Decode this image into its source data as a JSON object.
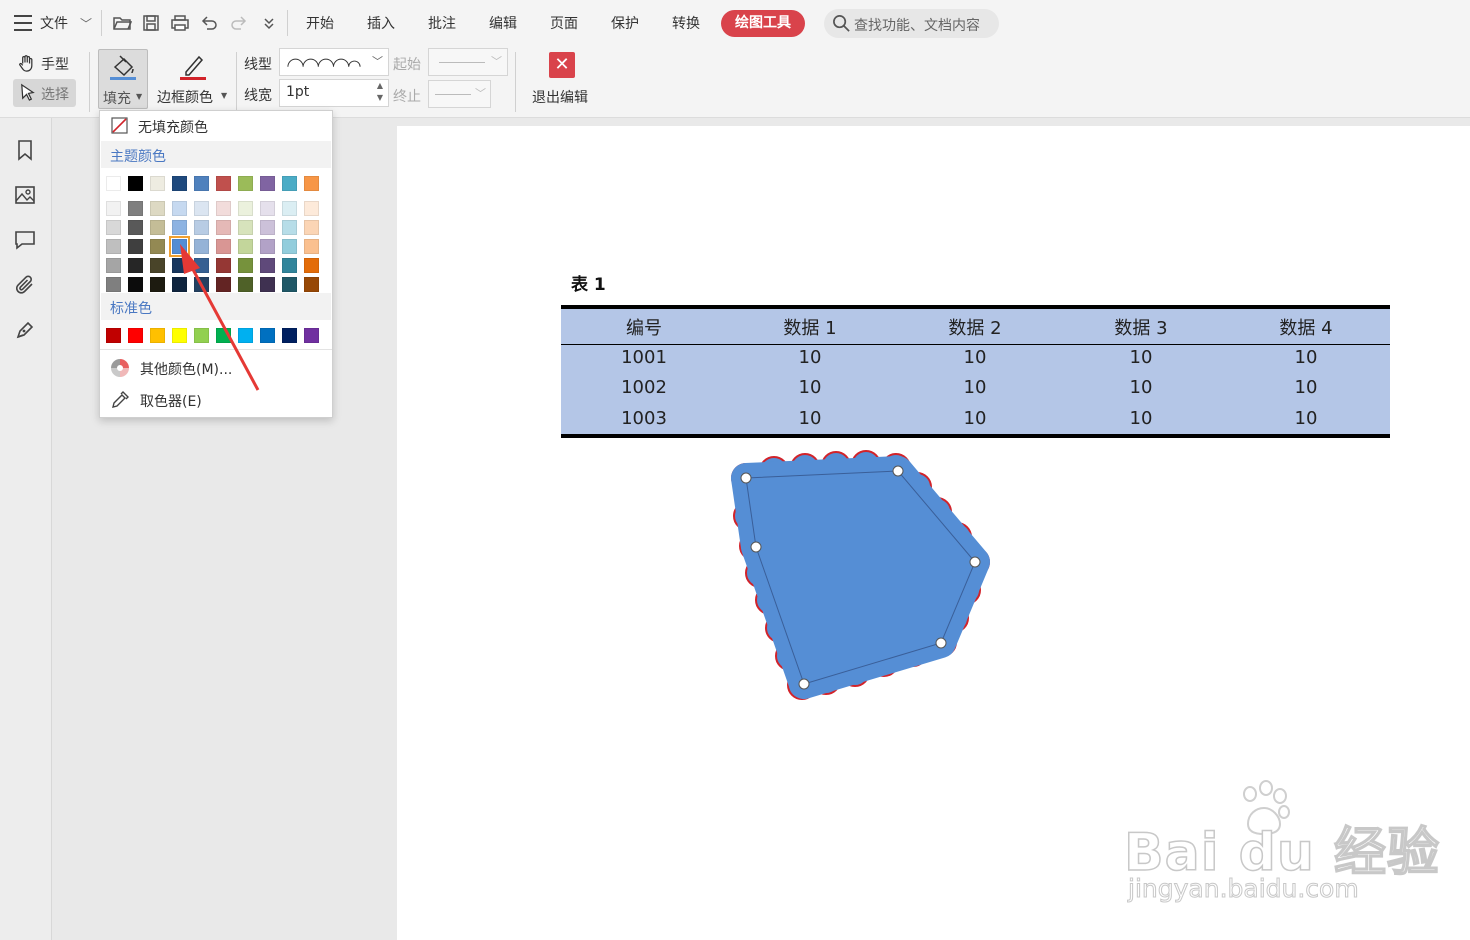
{
  "menubar": {
    "file_label": "文件",
    "tabs": [
      "开始",
      "插入",
      "批注",
      "编辑",
      "页面",
      "保护",
      "转换"
    ],
    "active_tab": "绘图工具",
    "search_placeholder": "查找功能、文档内容"
  },
  "ribbon": {
    "hand_label": "手型",
    "select_label": "选择",
    "fill_label": "填充",
    "border_color_label": "边框颜色",
    "line_type_label": "线型",
    "line_width_label": "线宽",
    "line_width_value": "1pt",
    "start_label": "起始",
    "end_label": "终止",
    "exit_label": "退出编辑"
  },
  "fill_menu": {
    "no_fill": "无填充颜色",
    "theme_colors_title": "主题颜色",
    "theme_top_row": [
      "#ffffff",
      "#000000",
      "#eeece1",
      "#1f497d",
      "#4f81bd",
      "#c0504d",
      "#9bbb59",
      "#8064a2",
      "#4bacc6",
      "#f79646"
    ],
    "theme_shades": [
      [
        "#f2f2f2",
        "#7f7f7f",
        "#ddd9c3",
        "#c6d9f0",
        "#dbe5f1",
        "#f2dcdb",
        "#ebf1dd",
        "#e5e0ec",
        "#dbeef3",
        "#fdeada"
      ],
      [
        "#d8d8d8",
        "#595959",
        "#c4bd97",
        "#8db3e2",
        "#b8cce4",
        "#e5b9b7",
        "#d7e3bc",
        "#ccc1d9",
        "#b7dde8",
        "#fbd5b5"
      ],
      [
        "#bfbfbf",
        "#3f3f3f",
        "#938953",
        "#548dd4",
        "#95b3d7",
        "#d99694",
        "#c3d69b",
        "#b2a2c7",
        "#92cddc",
        "#fac08f"
      ],
      [
        "#a5a5a5",
        "#262626",
        "#494429",
        "#17365d",
        "#366092",
        "#953734",
        "#76923c",
        "#5f497a",
        "#31859b",
        "#e36c09"
      ],
      [
        "#7f7f7f",
        "#0c0c0c",
        "#1d1b10",
        "#0f243e",
        "#244061",
        "#632423",
        "#4f6128",
        "#3f3151",
        "#205867",
        "#974806"
      ]
    ],
    "standard_colors_title": "标准色",
    "standard_colors": [
      "#c00000",
      "#ff0000",
      "#ffc000",
      "#ffff00",
      "#92d050",
      "#00b050",
      "#00b0f0",
      "#0070c0",
      "#002060",
      "#7030a0"
    ],
    "more_colors": "其他颜色(M)...",
    "eyedropper": "取色器(E)"
  },
  "document": {
    "table_caption": "表 1",
    "table": {
      "headers": [
        "编号",
        "数据 1",
        "数据 2",
        "数据 3",
        "数据 4"
      ],
      "rows": [
        [
          "1001",
          "10",
          "10",
          "10",
          "10"
        ],
        [
          "1002",
          "10",
          "10",
          "10",
          "10"
        ],
        [
          "1003",
          "10",
          "10",
          "10",
          "10"
        ]
      ]
    }
  },
  "colors": {
    "accent": "#d9434b",
    "shape_fill": "#558ed5",
    "shape_border": "#d2232a",
    "table_bg": "#b4c6e7"
  },
  "watermark": {
    "line1": "Bai du 经验",
    "line2": "jingyan.baidu.com"
  }
}
